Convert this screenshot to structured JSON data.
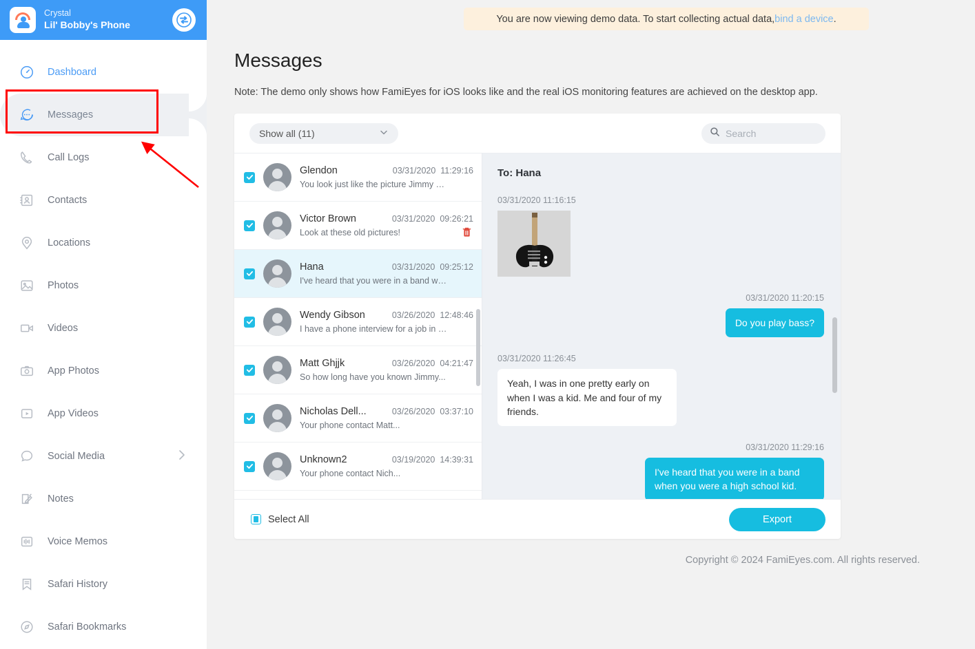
{
  "brand": {
    "account_name": "Crystal",
    "device_name": "Lil' Bobby's Phone",
    "logo_icon": "famieyes-logo-icon",
    "sync_icon": "sync-swap-icon",
    "bar_color": "#3e9bf7"
  },
  "sidebar": {
    "items": [
      {
        "label": "Dashboard",
        "icon": "speedometer-icon",
        "state": "link"
      },
      {
        "label": "Messages",
        "icon": "chat-bubble-dots-icon",
        "state": "current"
      },
      {
        "label": "Call Logs",
        "icon": "phone-icon",
        "state": "normal"
      },
      {
        "label": "Contacts",
        "icon": "contact-card-icon",
        "state": "normal"
      },
      {
        "label": "Locations",
        "icon": "map-pin-icon",
        "state": "normal"
      },
      {
        "label": "Photos",
        "icon": "image-icon",
        "state": "normal"
      },
      {
        "label": "Videos",
        "icon": "video-camera-icon",
        "state": "normal"
      },
      {
        "label": "App Photos",
        "icon": "camera-icon",
        "state": "normal"
      },
      {
        "label": "App Videos",
        "icon": "play-box-icon",
        "state": "normal"
      },
      {
        "label": "Social Media",
        "icon": "speech-bubble-icon",
        "state": "normal",
        "chevron": true
      },
      {
        "label": "Notes",
        "icon": "note-pencil-icon",
        "state": "normal"
      },
      {
        "label": "Voice Memos",
        "icon": "waveform-icon",
        "state": "normal"
      },
      {
        "label": "Safari History",
        "icon": "bookmark-lines-icon",
        "state": "normal"
      },
      {
        "label": "Safari Bookmarks",
        "icon": "compass-icon",
        "state": "normal"
      }
    ]
  },
  "banner": {
    "text_before": "You are now viewing demo data. To start collecting actual data, ",
    "link_text": "bind a device",
    "text_after": ".",
    "bg_color": "#fdf0dd",
    "link_color": "#7cb8f0"
  },
  "page": {
    "title": "Messages",
    "note": "Note: The demo only shows how FamiEyes for iOS looks like and the real iOS monitoring features are achieved on the desktop app."
  },
  "toolbar": {
    "filter_label": "Show all (11)",
    "filter_chevron_icon": "chevron-down-icon",
    "search_icon": "search-icon",
    "search_value": "",
    "search_placeholder": "Search"
  },
  "threads": [
    {
      "name": "Glendon",
      "date": "03/31/2020",
      "time": "11:29:16",
      "snippet": "You look just like the picture Jimmy sh...",
      "checked": true,
      "selected": false,
      "trash": false
    },
    {
      "name": "Victor Brown",
      "date": "03/31/2020",
      "time": "09:26:21",
      "snippet": "Look at these old pictures!",
      "checked": true,
      "selected": false,
      "trash": true
    },
    {
      "name": "Hana",
      "date": "03/31/2020",
      "time": "09:25:12",
      "snippet": "I've heard that you were in a band whe...",
      "checked": true,
      "selected": true,
      "trash": false
    },
    {
      "name": "Wendy Gibson",
      "date": "03/26/2020",
      "time": "12:48:46",
      "snippet": "I have a phone interview for a job in an...",
      "checked": true,
      "selected": false,
      "trash": false
    },
    {
      "name": "Matt Ghjjk",
      "date": "03/26/2020",
      "time": "04:21:47",
      "snippet": "So how long have you known Jimmy...",
      "checked": true,
      "selected": false,
      "trash": false
    },
    {
      "name": "Nicholas Dell...",
      "date": "03/26/2020",
      "time": "03:37:10",
      "snippet": "Your phone contact Matt...",
      "checked": true,
      "selected": false,
      "trash": false
    },
    {
      "name": "Unknown2",
      "date": "03/19/2020",
      "time": "14:39:31",
      "snippet": "Your phone contact Nich...",
      "checked": true,
      "selected": false,
      "trash": false
    }
  ],
  "conversation": {
    "header": "To: Hana",
    "messages": [
      {
        "direction": "in",
        "timestamp": "03/31/2020  11:16:15",
        "type": "image",
        "text": "",
        "image_alt": "bass-guitar-photo"
      },
      {
        "direction": "out",
        "timestamp": "03/31/2020  11:20:15",
        "type": "text",
        "text": "Do you play bass?"
      },
      {
        "direction": "in",
        "timestamp": "03/31/2020  11:26:45",
        "type": "text",
        "text": "Yeah, I was in one pretty early on when I was a kid. Me and four of my friends."
      },
      {
        "direction": "out",
        "timestamp": "03/31/2020  11:29:16",
        "type": "text",
        "text": "I've heard that you were in a band when you were a high school kid."
      }
    ],
    "bubble_out_color": "#16bde0",
    "bubble_in_color": "#ffffff",
    "bg_color": "#eef1f5"
  },
  "footer": {
    "select_all_label": "Select All",
    "export_label": "Export",
    "export_color": "#16bde0"
  },
  "copyright": "Copyright © 2024 FamiEyes.com. All rights reserved."
}
